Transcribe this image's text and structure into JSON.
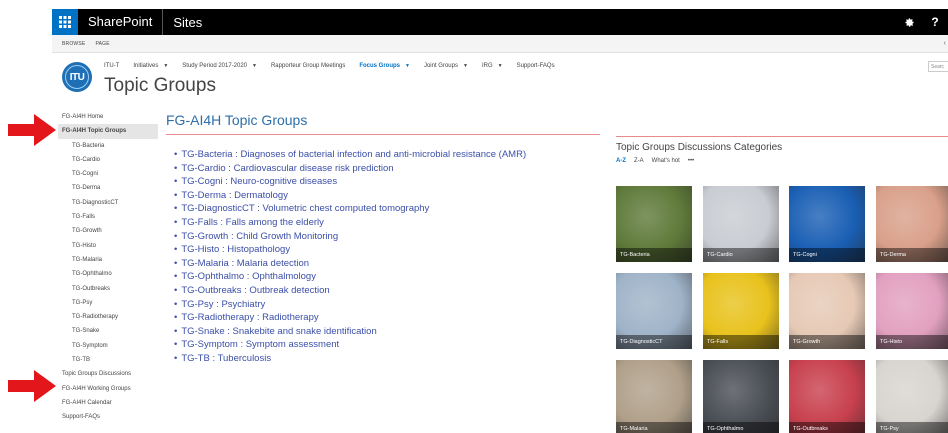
{
  "suite": {
    "app_title": "SharePoint",
    "sites_label": "Sites",
    "settings_icon": "gear-icon",
    "help_label": "?"
  },
  "ribbon": {
    "browse": "BROWSE",
    "page": "PAGE"
  },
  "site": {
    "title": "Topic Groups",
    "logo_text": "ITU"
  },
  "topnav": [
    {
      "label": "ITU-T",
      "dropdown": false
    },
    {
      "label": "Initiatives",
      "dropdown": true
    },
    {
      "label": "Study Period 2017-2020",
      "dropdown": true
    },
    {
      "label": "Rapporteur Group Meetings",
      "dropdown": false
    },
    {
      "label": "Focus Groups",
      "dropdown": true,
      "active": true
    },
    {
      "label": "Joint Groups",
      "dropdown": true
    },
    {
      "label": "IRG",
      "dropdown": true
    },
    {
      "label": "Support-FAQs",
      "dropdown": false
    }
  ],
  "search_placeholder": "Searc",
  "leftnav": [
    {
      "label": "FG-AI4H Home",
      "level": 0
    },
    {
      "label": "FG-AI4H Topic Groups",
      "level": 0,
      "selected": true
    },
    {
      "label": "TG-Bacteria",
      "level": 1
    },
    {
      "label": "TG-Cardio",
      "level": 1
    },
    {
      "label": "TG-Cogni",
      "level": 1
    },
    {
      "label": "TG-Derma",
      "level": 1
    },
    {
      "label": "TG-DiagnosticCT",
      "level": 1
    },
    {
      "label": "TG-Falls",
      "level": 1
    },
    {
      "label": "TG-Growth",
      "level": 1
    },
    {
      "label": "TG-Histo",
      "level": 1
    },
    {
      "label": "TG-Malaria",
      "level": 1
    },
    {
      "label": "TG-Ophthalmo",
      "level": 1
    },
    {
      "label": "TG-Outbreaks",
      "level": 1
    },
    {
      "label": "TG-Psy",
      "level": 1
    },
    {
      "label": "TG-Radiotherapy",
      "level": 1
    },
    {
      "label": "TG-Snake",
      "level": 1
    },
    {
      "label": "TG-Symptom",
      "level": 1
    },
    {
      "label": "TG-TB",
      "level": 1
    },
    {
      "label": "Topic Groups Discussions",
      "level": 0
    },
    {
      "label": "FG-AI4H Working Groups",
      "level": 0
    },
    {
      "label": "FG-AI4H Calendar",
      "level": 0
    },
    {
      "label": "Support-FAQs",
      "level": 0
    }
  ],
  "main": {
    "title": "FG-AI4H Topic Groups",
    "topics": [
      "TG-Bacteria : Diagnoses of bacterial infection and anti-microbial resistance (AMR)",
      "TG-Cardio : Cardiovascular disease risk prediction",
      "TG-Cogni : Neuro-cognitive diseases",
      "TG-Derma : Dermatology",
      "TG-DiagnosticCT : Volumetric chest computed tomography",
      "TG-Falls : Falls among the elderly",
      "TG-Growth : Child Growth Monitoring",
      "TG-Histo : Histopathology",
      "TG-Malaria : Malaria detection",
      "TG-Ophthalmo : Ophthalmology",
      "TG-Outbreaks : Outbreak detection",
      "TG-Psy : Psychiatry",
      "TG-Radiotherapy : Radiotherapy",
      "TG-Snake : Snakebite and snake identification",
      "TG-Symptom : Symptom assessment",
      "TG-TB : Tuberculosis"
    ]
  },
  "discussions": {
    "title": "Topic Groups Discussions Categories",
    "sort": [
      "A-Z",
      "Z-A",
      "What's hot",
      "•••"
    ],
    "tiles": [
      {
        "label": "TG-Bacteria",
        "color": "#5f7a3a"
      },
      {
        "label": "TG-Cardio",
        "color": "#c9ccd2"
      },
      {
        "label": "TG-Cogni",
        "color": "#1a5fb4"
      },
      {
        "label": "TG-Derma",
        "color": "#d9a08a"
      },
      {
        "label": "TG-DiagnosticCT",
        "color": "#9fb3c8"
      },
      {
        "label": "TG-Falls",
        "color": "#e8c21c"
      },
      {
        "label": "TG-Growth",
        "color": "#e6c9b5"
      },
      {
        "label": "TG-Histo",
        "color": "#e2a0c0"
      },
      {
        "label": "TG-Malaria",
        "color": "#b0a08a"
      },
      {
        "label": "TG-Ophthalmo",
        "color": "#4a4e55"
      },
      {
        "label": "TG-Outbreaks",
        "color": "#c8404e"
      },
      {
        "label": "TG-Psy",
        "color": "#d8d4d0"
      }
    ]
  }
}
